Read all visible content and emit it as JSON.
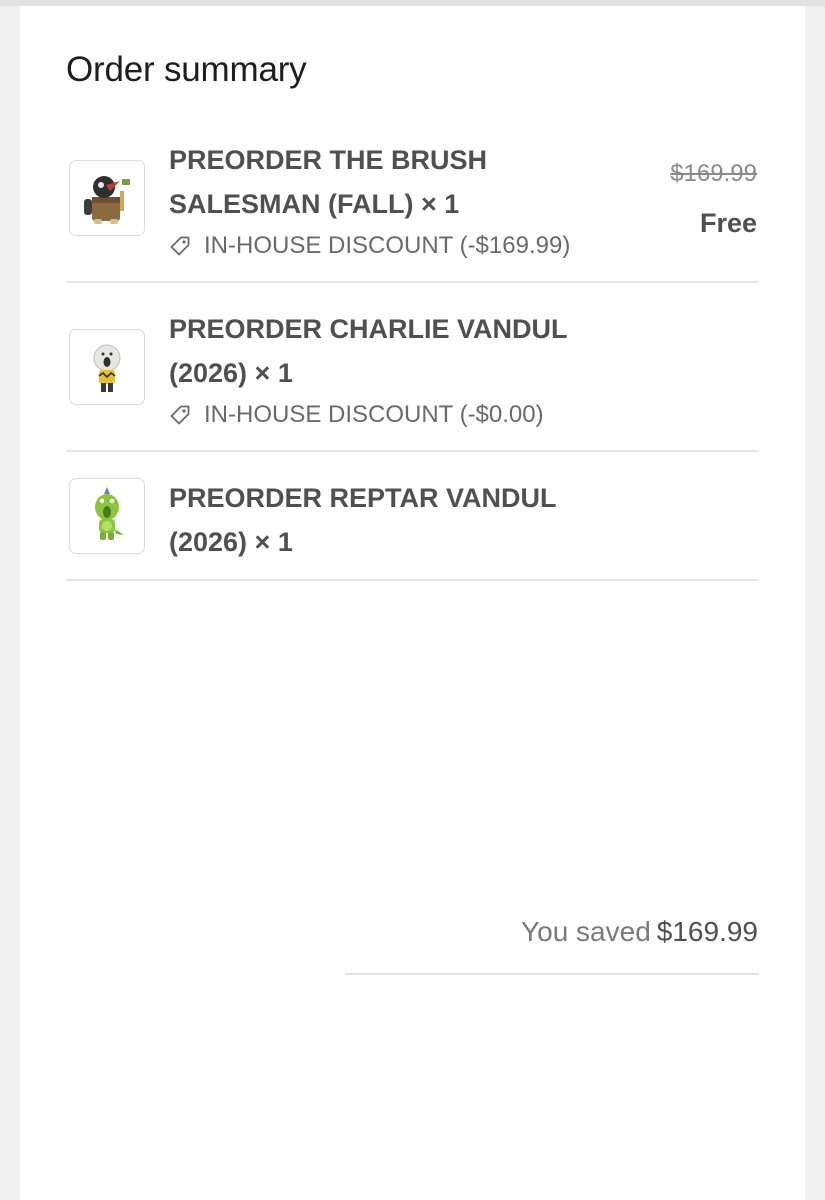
{
  "summary": {
    "title": "Order summary"
  },
  "items": [
    {
      "name": "PREORDER THE BRUSH SALESMAN (FALL) × 1",
      "discount": "IN-HOUSE DISCOUNT (-$169.99)",
      "original_price": "$169.99",
      "final_price": "Free",
      "thumbnail_icon": "brush-salesman-figure-icon"
    },
    {
      "name": "PREORDER CHARLIE VANDUL (2026) × 1",
      "discount": "IN-HOUSE DISCOUNT (-$0.00)",
      "thumbnail_icon": "charlie-vandul-figure-icon"
    },
    {
      "name": "PREORDER REPTAR VANDUL (2026) × 1",
      "thumbnail_icon": "reptar-vandul-figure-icon"
    }
  ],
  "savings": {
    "label": "You saved",
    "amount": "$169.99"
  },
  "colors": {
    "text_primary": "#1e1e1e",
    "text_item": "#505050",
    "text_muted": "#6a6a6a",
    "divider": "#e6e6e6",
    "page_background": "#f0f0f0"
  }
}
